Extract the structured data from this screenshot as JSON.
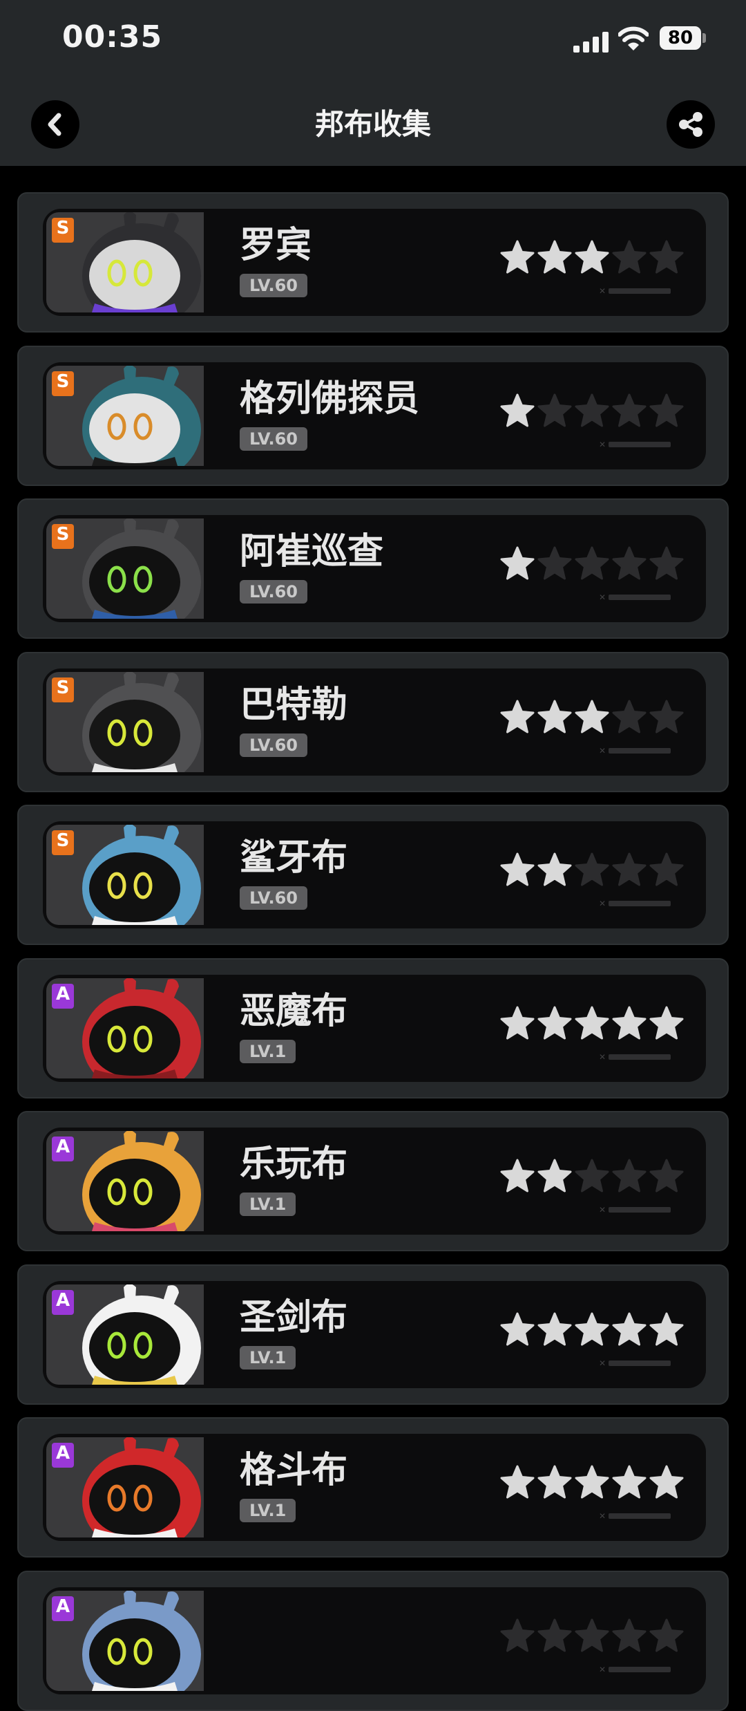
{
  "status_bar": {
    "time": "00:35",
    "battery": "80",
    "signal_icon": "cellular-signal-icon",
    "wifi_icon": "wifi-icon"
  },
  "header": {
    "title": "邦布收集",
    "back_icon": "chevron-left-icon",
    "share_icon": "share-icon"
  },
  "bangboo_list": [
    {
      "rank": "S",
      "name": "罗宾",
      "level": "LV.60",
      "stars": 3,
      "portrait": {
        "bg": "#3a3a3c",
        "body": "#2e2e31",
        "face": "#d8d8d8",
        "eye": "#d6e83a",
        "accent": "#6a3fd0"
      }
    },
    {
      "rank": "S",
      "name": "格列佛探员",
      "level": "LV.60",
      "stars": 1,
      "portrait": {
        "bg": "#3a3a3c",
        "body": "#2f6e7a",
        "face": "#e3e3e3",
        "eye": "#d98c2a",
        "accent": "#1b1b1b"
      }
    },
    {
      "rank": "S",
      "name": "阿崔巡查",
      "level": "LV.60",
      "stars": 1,
      "portrait": {
        "bg": "#3a3a3c",
        "body": "#4a4a4c",
        "face": "#111111",
        "eye": "#8be04a",
        "accent": "#2f5fa8"
      }
    },
    {
      "rank": "S",
      "name": "巴特勒",
      "level": "LV.60",
      "stars": 3,
      "portrait": {
        "bg": "#3a3a3c",
        "body": "#505052",
        "face": "#161616",
        "eye": "#d8e83a",
        "accent": "#e8e8e8"
      }
    },
    {
      "rank": "S",
      "name": "鲨牙布",
      "level": "LV.60",
      "stars": 2,
      "portrait": {
        "bg": "#3a3a3c",
        "body": "#5a9fc8",
        "face": "#111111",
        "eye": "#e8e04a",
        "accent": "#f2f2f2"
      }
    },
    {
      "rank": "A",
      "name": "恶魔布",
      "level": "LV.1",
      "stars": 5,
      "portrait": {
        "bg": "#3a3a3c",
        "body": "#c8282e",
        "face": "#111111",
        "eye": "#d8e83a",
        "accent": "#8a1c20"
      }
    },
    {
      "rank": "A",
      "name": "乐玩布",
      "level": "LV.1",
      "stars": 2,
      "portrait": {
        "bg": "#3a3a3c",
        "body": "#e8a23a",
        "face": "#111111",
        "eye": "#d8e83a",
        "accent": "#d84a6a"
      }
    },
    {
      "rank": "A",
      "name": "圣剑布",
      "level": "LV.1",
      "stars": 5,
      "portrait": {
        "bg": "#3a3a3c",
        "body": "#f2f2f2",
        "face": "#111111",
        "eye": "#a8e83a",
        "accent": "#e8c84a"
      }
    },
    {
      "rank": "A",
      "name": "格斗布",
      "level": "LV.1",
      "stars": 5,
      "portrait": {
        "bg": "#3a3a3c",
        "body": "#d0282a",
        "face": "#111111",
        "eye": "#e87a2a",
        "accent": "#f2f2f2"
      }
    },
    {
      "rank": "A",
      "name": "",
      "level": "",
      "stars": 0,
      "portrait": {
        "bg": "#3a3a3c",
        "body": "#7a9ac8",
        "face": "#111111",
        "eye": "#d8e83a",
        "accent": "#f2f2f2"
      }
    }
  ],
  "max_stars": 5,
  "colors": {
    "rank_S": "#e8721c",
    "rank_A": "#9a38d8",
    "star_on": "#d9d9d9",
    "star_off": "#2c2c2e",
    "background": "#000000",
    "card": "#25282a"
  }
}
